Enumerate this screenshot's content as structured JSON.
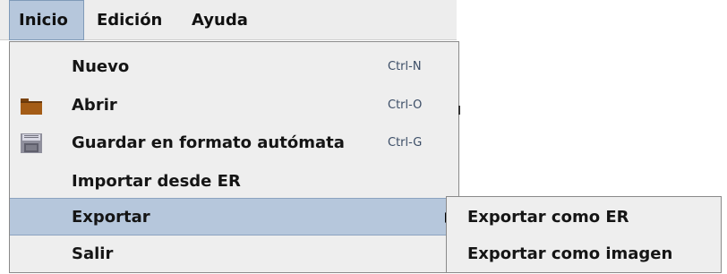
{
  "menubar": {
    "items": [
      {
        "label": "Inicio",
        "active": true
      },
      {
        "label": "Edición",
        "active": false
      },
      {
        "label": "Ayuda",
        "active": false
      }
    ]
  },
  "menu": {
    "items": [
      {
        "label": "Nuevo",
        "accelerator": "Ctrl-N",
        "icon": ""
      },
      {
        "label": "Abrir",
        "accelerator": "Ctrl-O",
        "icon": "folder-icon"
      },
      {
        "label": "Guardar en formato autómata",
        "accelerator": "Ctrl-G",
        "icon": "save-icon"
      },
      {
        "label": "Importar desde ER",
        "accelerator": "",
        "icon": ""
      },
      {
        "label": "Exportar",
        "accelerator": "",
        "icon": "",
        "highlighted": true,
        "has_submenu": true
      },
      {
        "label": "Salir",
        "accelerator": "",
        "icon": ""
      }
    ]
  },
  "submenu": {
    "items": [
      {
        "label": "Exportar como ER"
      },
      {
        "label": "Exportar como imagen"
      }
    ]
  },
  "colors": {
    "highlight": "#b6c7dc",
    "menu_background": "#eeeeee",
    "folder": "#a45c16",
    "accelerator_text": "#3b4d66"
  }
}
